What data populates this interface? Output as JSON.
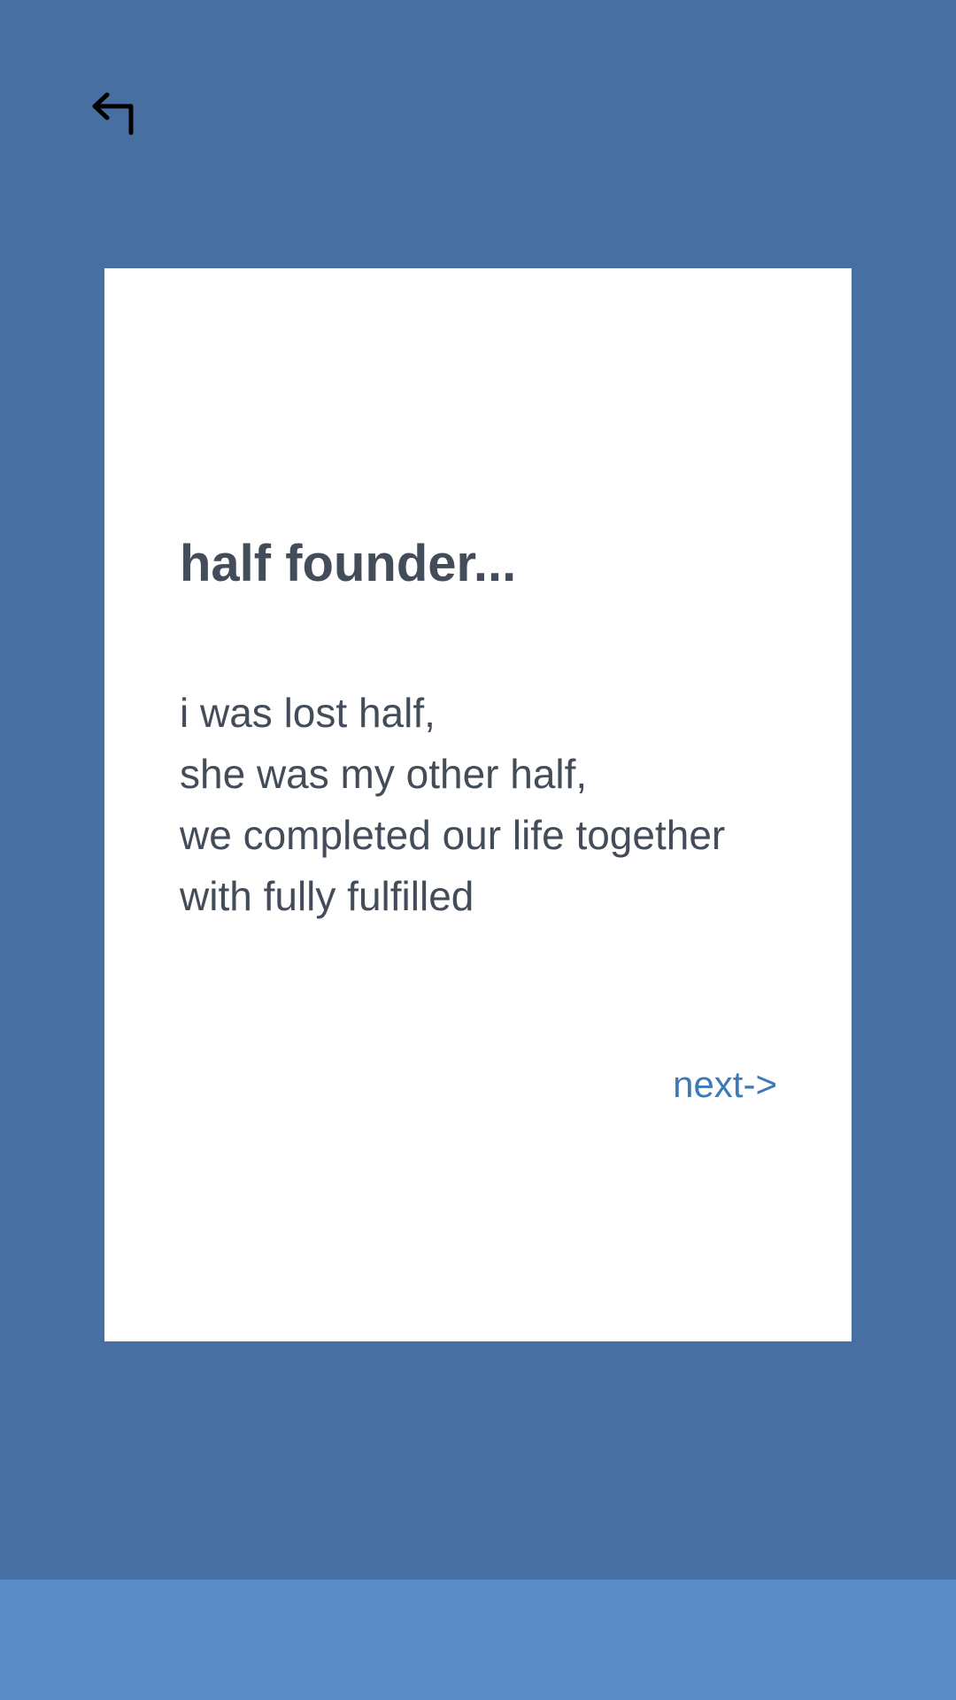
{
  "nav": {
    "back_icon": "back-arrow-icon"
  },
  "card": {
    "title": "half founder...",
    "body_lines": [
      "i was lost half,",
      "she was my other half,",
      "we completed our life together",
      "with fully fulfilled"
    ],
    "next_label": "next->"
  },
  "colors": {
    "background": "#476fa1",
    "card": "#ffffff",
    "text": "#434c59",
    "link": "#3d79b8",
    "bottom_bar": "#5a8dc8"
  }
}
